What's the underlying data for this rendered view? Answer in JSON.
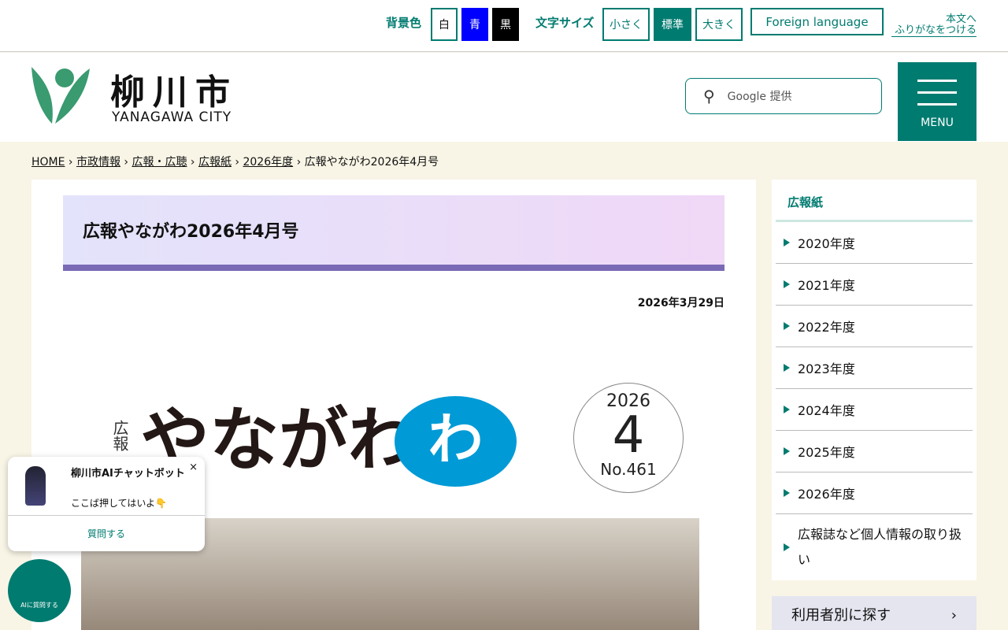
{
  "topbar": {
    "bg_label": "背景色",
    "bg_white": "白",
    "bg_blue": "青",
    "bg_black": "黒",
    "font_label": "文字サイズ",
    "small": "小さく",
    "normal": "標準",
    "large": "大きく",
    "foreign": "Foreign language",
    "furigana_1": "本文へ",
    "furigana_2": "ふりがなをつける"
  },
  "header": {
    "logo_name": "柳川市",
    "logo_sub": "YANAGAWA CITY",
    "search_placeholder": "Google 提供",
    "menu": "MENU"
  },
  "breadcrumb": [
    "HOME",
    "市政情報",
    "広報・広聴",
    "広報紙",
    "2026年度",
    "広報やながわ2026年4月号"
  ],
  "main": {
    "title": "広報やながわ2026年4月号",
    "date": "2026年3月29日",
    "cover": {
      "kouhou": "広報",
      "name": "やながわ",
      "wa": "わ",
      "year": "2026",
      "month": "4",
      "number": "No.461"
    }
  },
  "sidebar": {
    "heading": "広報紙",
    "items": [
      "2020年度",
      "2021年度",
      "2022年度",
      "2023年度",
      "2024年度",
      "2025年度",
      "2026年度",
      "広報誌など個人情報の取り扱い"
    ],
    "next_box": "利用者別に探す"
  },
  "chat": {
    "title": "柳川市AIチャットボット",
    "message": "ここば押してはいよ👇",
    "ask": "質問する",
    "close": "×",
    "fab": "AIに質問する"
  }
}
